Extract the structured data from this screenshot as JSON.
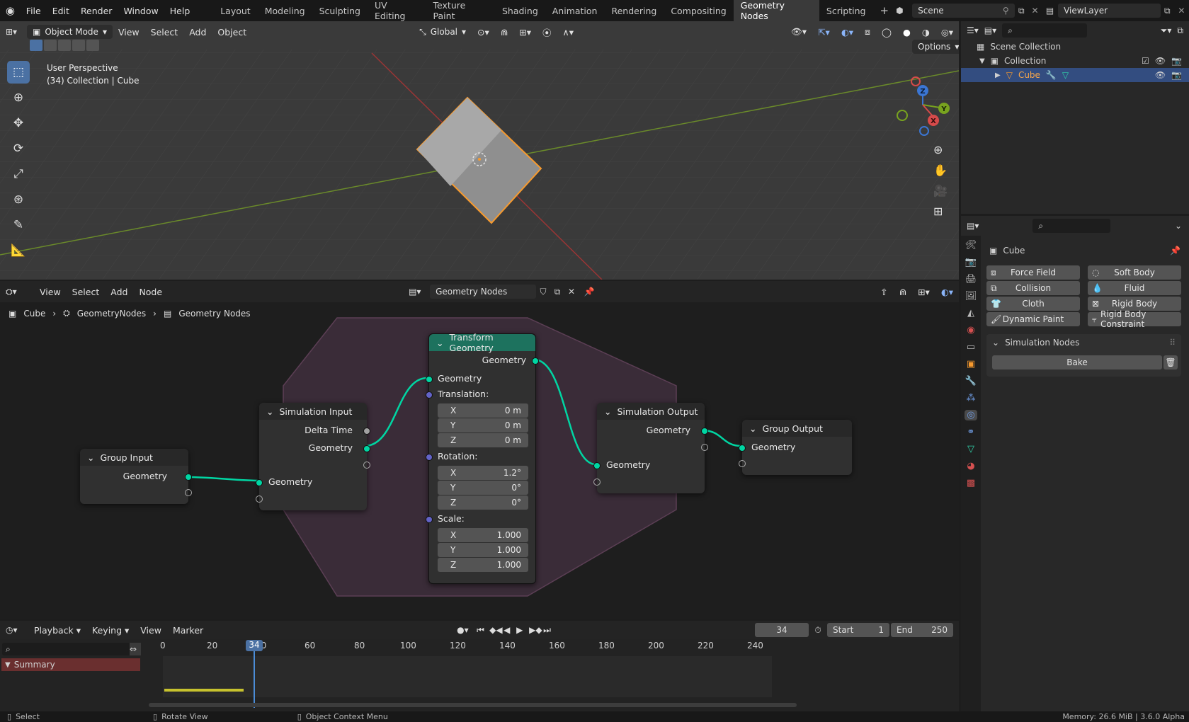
{
  "topbar": {
    "menus": [
      "File",
      "Edit",
      "Render",
      "Window",
      "Help"
    ],
    "workspaces": [
      "Layout",
      "Modeling",
      "Sculpting",
      "UV Editing",
      "Texture Paint",
      "Shading",
      "Animation",
      "Rendering",
      "Compositing",
      "Geometry Nodes",
      "Scripting"
    ],
    "active_workspace": "Geometry Nodes",
    "add_tab": "+",
    "scene": "Scene",
    "view_layer": "ViewLayer"
  },
  "viewport": {
    "mode": "Object Mode",
    "menus": [
      "View",
      "Select",
      "Add",
      "Object"
    ],
    "orientation": "Global",
    "options": "Options",
    "overlay_title": "User Perspective",
    "overlay_subtitle": "(34) Collection | Cube",
    "gizmo_axes": {
      "x": "X",
      "y": "Y",
      "z": "Z"
    }
  },
  "node_editor": {
    "menus": [
      "View",
      "Select",
      "Add",
      "Node"
    ],
    "tree_name": "Geometry Nodes",
    "breadcrumb": [
      "Cube",
      "GeometryNodes",
      "Geometry Nodes"
    ],
    "nodes": {
      "group_input": {
        "title": "Group Input",
        "out_geometry": "Geometry"
      },
      "sim_input": {
        "title": "Simulation Input",
        "delta_time": "Delta Time",
        "out_geometry": "Geometry",
        "in_geometry": "Geometry"
      },
      "transform": {
        "title": "Transform Geometry",
        "out_geometry": "Geometry",
        "in_geometry": "Geometry",
        "translation": "Translation:",
        "rotation": "Rotation:",
        "scale": "Scale:",
        "tx": "0 m",
        "ty": "0 m",
        "tz": "0 m",
        "rx": "1.2°",
        "ry": "0°",
        "rz": "0°",
        "sx": "1.000",
        "sy": "1.000",
        "sz": "1.000",
        "axes": [
          "X",
          "Y",
          "Z"
        ]
      },
      "sim_output": {
        "title": "Simulation Output",
        "out_geometry": "Geometry",
        "in_geometry": "Geometry"
      },
      "group_output": {
        "title": "Group Output",
        "in_geometry": "Geometry"
      }
    }
  },
  "timeline": {
    "menus": [
      "Playback",
      "Keying",
      "View",
      "Marker"
    ],
    "current_frame": "34",
    "start_label": "Start",
    "start": "1",
    "end_label": "End",
    "end": "250",
    "ruler": [
      "0",
      "20",
      "40",
      "60",
      "80",
      "100",
      "120",
      "140",
      "160",
      "180",
      "200",
      "220",
      "240"
    ],
    "playhead": "34",
    "summary": "Summary"
  },
  "outliner": {
    "scene_collection": "Scene Collection",
    "collection": "Collection",
    "object": "Cube"
  },
  "properties": {
    "object_name": "Cube",
    "physics_buttons": [
      "Force Field",
      "Soft Body",
      "Collision",
      "Fluid",
      "Cloth",
      "Rigid Body",
      "Dynamic Paint",
      "Rigid Body Constraint"
    ],
    "panel_title": "Simulation Nodes",
    "bake_label": "Bake"
  },
  "statusbar": {
    "select": "Select",
    "rotate": "Rotate View",
    "context": "Object Context Menu",
    "memory": "Memory: 26.6 MiB | 3.6.0 Alpha"
  },
  "colors": {
    "accent": "#4b71a3",
    "geometry_socket": "#00d6a3",
    "selection": "#f79a2e",
    "transform_header": "#1d725e"
  }
}
